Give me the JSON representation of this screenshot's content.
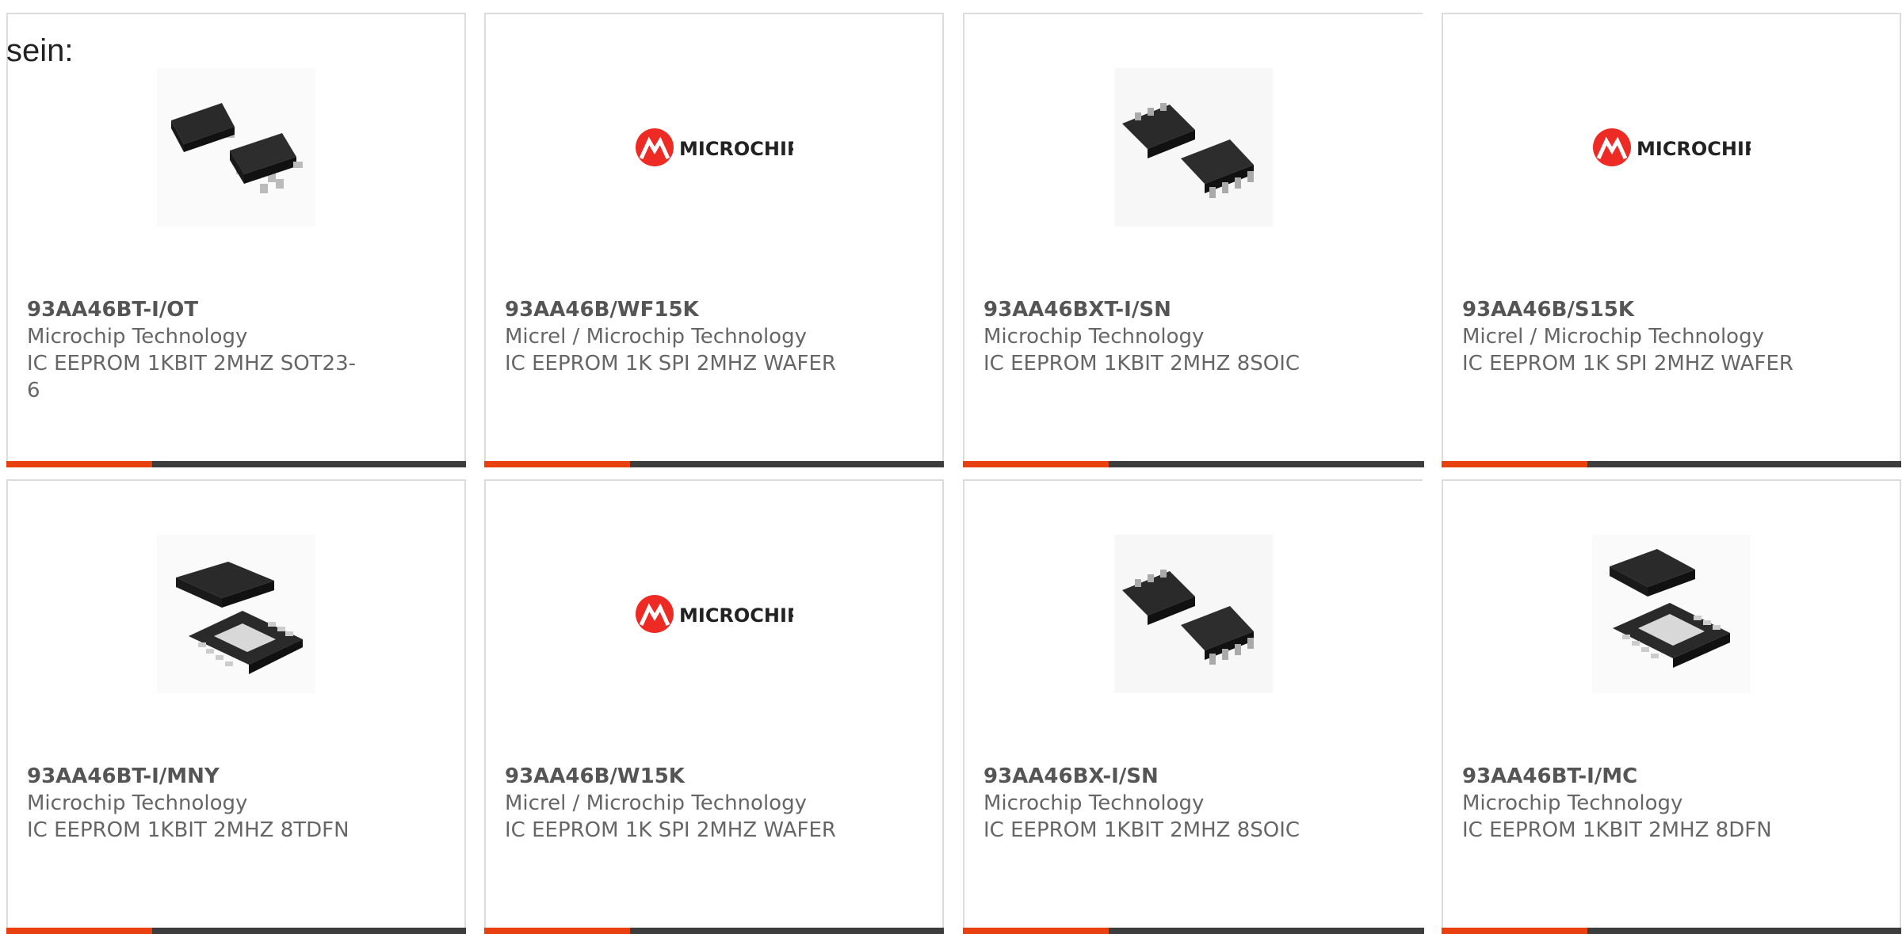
{
  "intro_text": "sein:",
  "accent_color": "#e8400f",
  "brand_logo_text": "MICROCHIP",
  "products": [
    {
      "part": "93AA46BT-I/OT",
      "manufacturer": "Microchip Technology",
      "description": "IC EEPROM 1KBIT 2MHZ SOT23-6",
      "image": "sot23-6-chip-icon"
    },
    {
      "part": "93AA46B/WF15K",
      "manufacturer": "Micrel / Microchip Technology",
      "description": "IC EEPROM 1K SPI 2MHZ WAFER",
      "image": "microchip-logo-icon"
    },
    {
      "part": "93AA46BXT-I/SN",
      "manufacturer": "Microchip Technology",
      "description": "IC EEPROM 1KBIT 2MHZ 8SOIC",
      "image": "soic8-chip-icon"
    },
    {
      "part": "93AA46B/S15K",
      "manufacturer": "Micrel / Microchip Technology",
      "description": "IC EEPROM 1K SPI 2MHZ WAFER",
      "image": "microchip-logo-icon"
    },
    {
      "part": "93AA46BT-I/MNY",
      "manufacturer": "Microchip Technology",
      "description": "IC EEPROM 1KBIT 2MHZ 8TDFN",
      "image": "tdfn8-chip-icon"
    },
    {
      "part": "93AA46B/W15K",
      "manufacturer": "Micrel / Microchip Technology",
      "description": "IC EEPROM 1K SPI 2MHZ WAFER",
      "image": "microchip-logo-icon"
    },
    {
      "part": "93AA46BX-I/SN",
      "manufacturer": "Microchip Technology",
      "description": "IC EEPROM 1KBIT 2MHZ 8SOIC",
      "image": "soic8-chip-icon"
    },
    {
      "part": "93AA46BT-I/MC",
      "manufacturer": "Microchip Technology",
      "description": "IC EEPROM 1KBIT 2MHZ 8DFN",
      "image": "dfn8-chip-icon"
    }
  ]
}
